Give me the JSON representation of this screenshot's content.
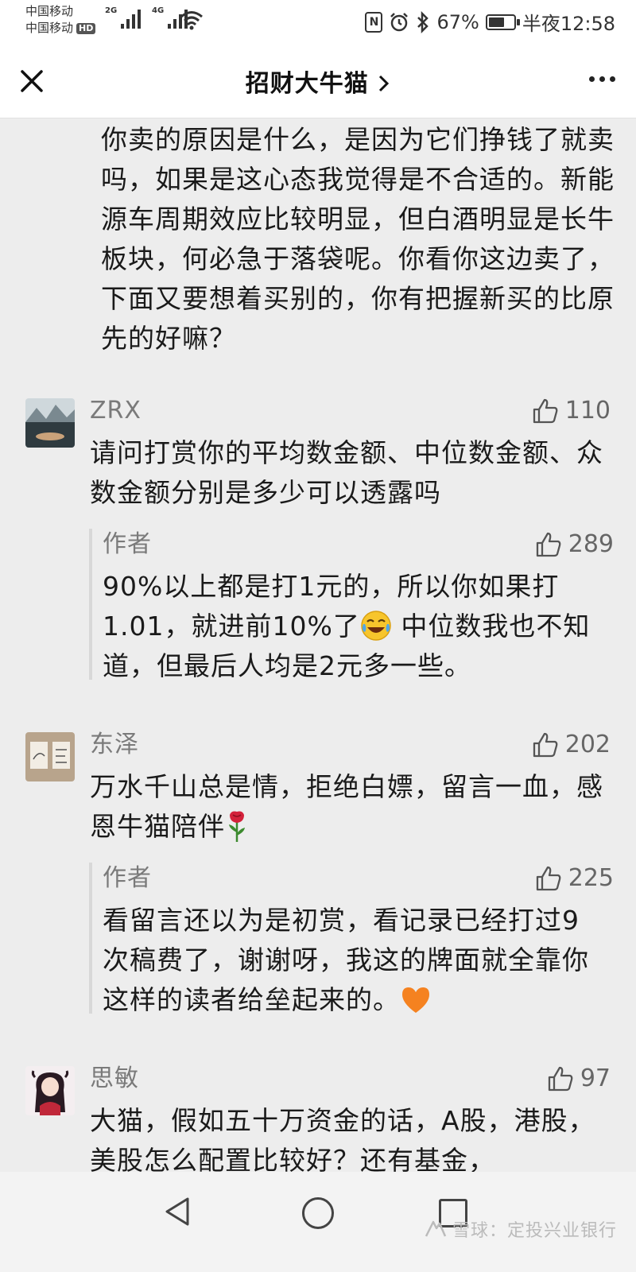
{
  "status_bar": {
    "carrier_1": "中国移动",
    "carrier_2": "中国移动",
    "hd_badge": "HD",
    "signal_1": "2G",
    "signal_2": "4G",
    "battery_percent": "67%",
    "battery_level": 0.67,
    "time": "半夜12:58",
    "nfc_label": "N"
  },
  "nav": {
    "title": "招财大牛猫"
  },
  "first_comment": {
    "text": "你卖的原因是什么，是因为它们挣钱了就卖吗，如果是这心态我觉得是不合适的。新能源车周期效应比较明显，但白酒明显是长牛板块，何必急于落袋呢。你看你这边卖了，下面又要想着买别的，你有把握新买的比原先的好嘛？"
  },
  "comments": [
    {
      "name": "ZRX",
      "likes": "110",
      "text": "请问打赏你的平均数金额、中位数金额、众数金额分别是多少可以透露吗",
      "reply": {
        "author": "作者",
        "likes": "289",
        "text_before_emoji": "90%以上都是打1元的，所以你如果打1.01，就进前10%了",
        "text_after_emoji": " 中位数我也不知道，但最后人均是2元多一些。"
      }
    },
    {
      "name": "东泽",
      "likes": "202",
      "text": "万水千山总是情，拒绝白嫖，留言一血，感恩牛猫陪伴",
      "reply": {
        "author": "作者",
        "likes": "225",
        "text": "看留言还以为是初赏，看记录已经打过9次稿费了，谢谢呀，我这的牌面就全靠你这样的读者给垒起来的。"
      }
    },
    {
      "name": "思敏",
      "likes": "97",
      "text": "大猫，假如五十万资金的话，A股，港股，美股怎么配置比较好？还有基金，"
    }
  ],
  "watermark": "雪球：定投兴业银行",
  "colors": {
    "page_bg": "#ededed",
    "bar_bg": "#ffffff",
    "name_gray": "#7a7a7a",
    "reply_border": "#d8d8d8"
  }
}
